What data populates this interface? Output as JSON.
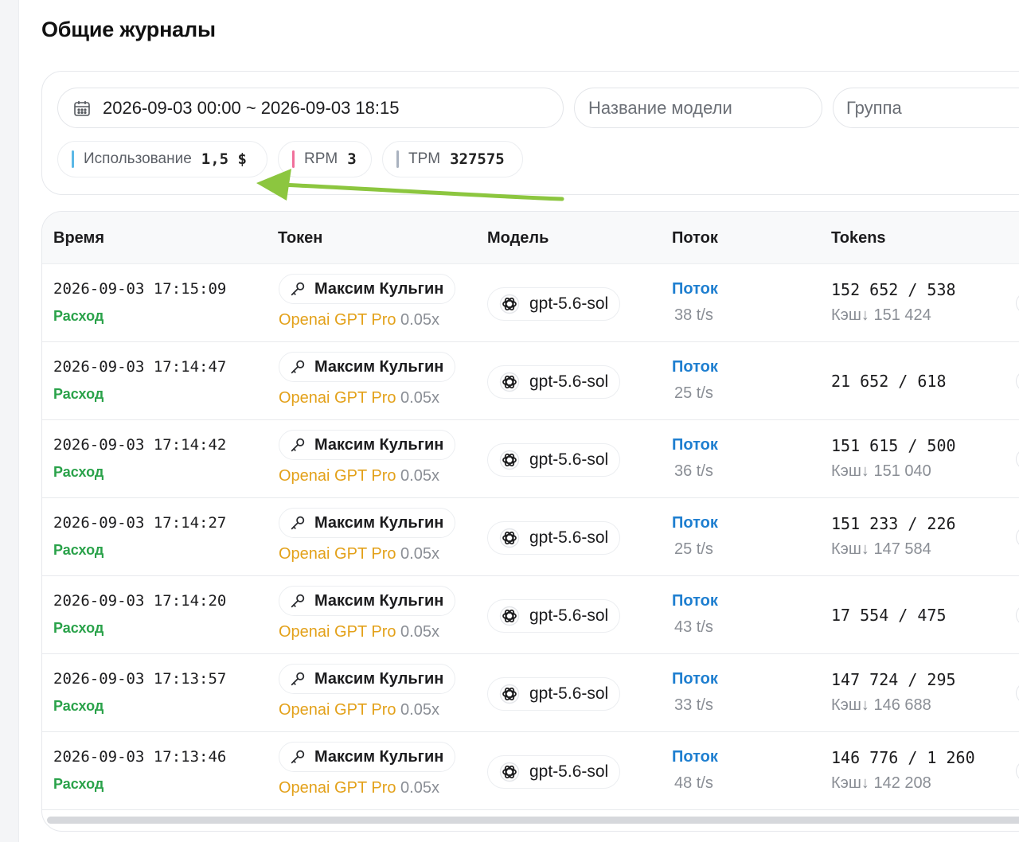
{
  "page": {
    "title": "Общие журналы"
  },
  "filters": {
    "date_range": "2026-09-03 00:00 ~ 2026-09-03 18:15",
    "model_placeholder": "Название модели",
    "group_placeholder": "Группа"
  },
  "stats": {
    "usage_label": "Использование",
    "usage_value": "1,5 $",
    "rpm_label": "RPM",
    "rpm_value": "3",
    "tpm_label": "TPM",
    "tpm_value": "327575"
  },
  "colors": {
    "accent_green": "#2aa24a",
    "stream_blue": "#1f7fd0",
    "group_orange": "#e3a11a",
    "annotation_arrow": "#8cc63f"
  },
  "table": {
    "headers": {
      "time": "Время",
      "token": "Токен",
      "model": "Модель",
      "stream": "Поток",
      "tokens": "Tokens"
    },
    "rows": [
      {
        "time": "2026-09-03 17:15:09",
        "kind": "Расход",
        "token": "Максим Кульгин",
        "group": "Openai GPT Pro",
        "ratio": "0.05x",
        "model": "gpt-5.6-sol",
        "stream": "Поток",
        "speed": "38 t/s",
        "tokens": "152 652 / 538",
        "cache": "Кэш↓ 151 424"
      },
      {
        "time": "2026-09-03 17:14:47",
        "kind": "Расход",
        "token": "Максим Кульгин",
        "group": "Openai GPT Pro",
        "ratio": "0.05x",
        "model": "gpt-5.6-sol",
        "stream": "Поток",
        "speed": "25 t/s",
        "tokens": "21 652 / 618",
        "cache": ""
      },
      {
        "time": "2026-09-03 17:14:42",
        "kind": "Расход",
        "token": "Максим Кульгин",
        "group": "Openai GPT Pro",
        "ratio": "0.05x",
        "model": "gpt-5.6-sol",
        "stream": "Поток",
        "speed": "36 t/s",
        "tokens": "151 615 / 500",
        "cache": "Кэш↓ 151 040"
      },
      {
        "time": "2026-09-03 17:14:27",
        "kind": "Расход",
        "token": "Максим Кульгин",
        "group": "Openai GPT Pro",
        "ratio": "0.05x",
        "model": "gpt-5.6-sol",
        "stream": "Поток",
        "speed": "25 t/s",
        "tokens": "151 233 / 226",
        "cache": "Кэш↓ 147 584"
      },
      {
        "time": "2026-09-03 17:14:20",
        "kind": "Расход",
        "token": "Максим Кульгин",
        "group": "Openai GPT Pro",
        "ratio": "0.05x",
        "model": "gpt-5.6-sol",
        "stream": "Поток",
        "speed": "43 t/s",
        "tokens": "17 554 / 475",
        "cache": ""
      },
      {
        "time": "2026-09-03 17:13:57",
        "kind": "Расход",
        "token": "Максим Кульгин",
        "group": "Openai GPT Pro",
        "ratio": "0.05x",
        "model": "gpt-5.6-sol",
        "stream": "Поток",
        "speed": "33 t/s",
        "tokens": "147 724 / 295",
        "cache": "Кэш↓ 146 688"
      },
      {
        "time": "2026-09-03 17:13:46",
        "kind": "Расход",
        "token": "Максим Кульгин",
        "group": "Openai GPT Pro",
        "ratio": "0.05x",
        "model": "gpt-5.6-sol",
        "stream": "Поток",
        "speed": "48 t/s",
        "tokens": "146 776 / 1 260",
        "cache": "Кэш↓ 142 208"
      }
    ]
  }
}
